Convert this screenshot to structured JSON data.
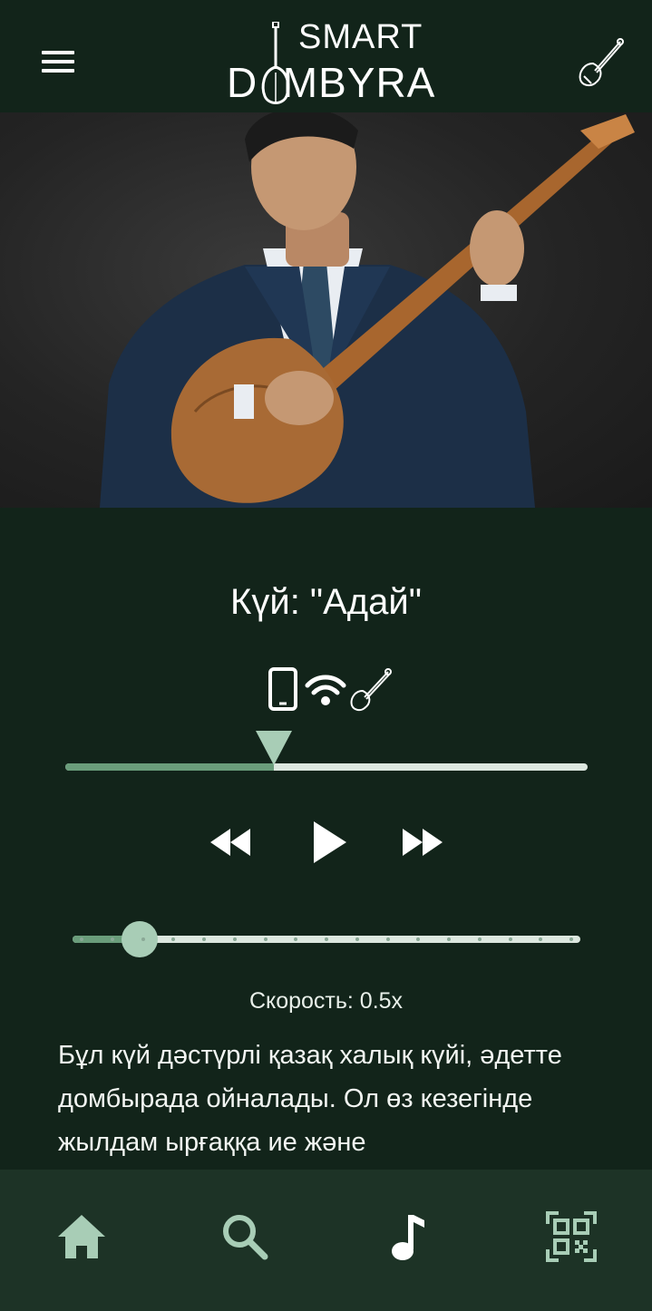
{
  "header": {
    "menu_icon": "hamburger-menu-icon",
    "logo": {
      "line1": "SMART",
      "line2": "D  MBYRA",
      "icon": "dombyra-logo-icon"
    },
    "right_icon": "dombyra-icon"
  },
  "hero": {
    "image": "dombyra-player-photo"
  },
  "player": {
    "title": "Күй: \"Адай\"",
    "connection_icons": [
      "phone-icon",
      "wifi-icon",
      "dombyra-icon"
    ],
    "progress": 0.4,
    "controls": [
      "rewind-icon",
      "play-icon",
      "fast-forward-icon"
    ],
    "speed_value": 0.5,
    "speed_steps": 16,
    "speed_level_index": 1,
    "speed_label": "Скорость: 0.5x"
  },
  "description": "Бұл күй дәстүрлі қазақ халық күйі, әдетте домбырада ойналады. Ол өз кезегінде жылдам ырғаққа ие және",
  "nav": {
    "items": [
      {
        "icon": "home-icon",
        "active": false
      },
      {
        "icon": "search-icon",
        "active": false
      },
      {
        "icon": "music-note-icon",
        "active": true
      },
      {
        "icon": "qr-code-icon",
        "active": false
      }
    ]
  },
  "colors": {
    "background": "#12241a",
    "nav_background": "#1d3326",
    "accent": "#a8cdb6",
    "accent_dark": "#6a9d7b",
    "track_light": "#dce7df"
  }
}
